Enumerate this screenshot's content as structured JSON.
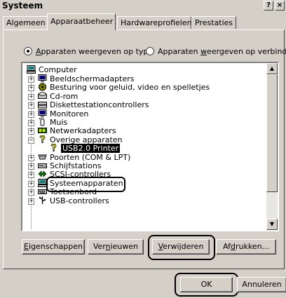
{
  "window": {
    "title": "Systeem",
    "help_label": "?",
    "close_label": "×"
  },
  "tabs": [
    {
      "label": "Algemeen"
    },
    {
      "label": "Apparaatbeheer"
    },
    {
      "label": "Hardwareprofielen"
    },
    {
      "label": "Prestaties"
    }
  ],
  "view_options": {
    "by_type_pre": "",
    "by_type_key": "A",
    "by_type_post": "pparaten weergeven op type",
    "by_connection_pre": "Apparaten ",
    "by_connection_key": "w",
    "by_connection_post": "eergeven op verbinding"
  },
  "tree": {
    "root": "Computer",
    "items": [
      {
        "label": "Beeldschermadapters",
        "icon": "monitor-icon",
        "expander": "+"
      },
      {
        "label": "Besturing voor geluid, video en spelletjes",
        "icon": "sound-icon",
        "expander": "+"
      },
      {
        "label": "Cd-rom",
        "icon": "cdrom-icon",
        "expander": "+"
      },
      {
        "label": "Diskettestationcontrollers",
        "icon": "floppy-controller-icon",
        "expander": "+"
      },
      {
        "label": "Monitoren",
        "icon": "monitor-icon",
        "expander": "+"
      },
      {
        "label": "Muis",
        "icon": "mouse-icon",
        "expander": "+"
      },
      {
        "label": "Netwerkadapters",
        "icon": "network-icon",
        "expander": "+"
      },
      {
        "label": "Overige apparaten",
        "icon": "unknown-device-icon",
        "expander": "−"
      },
      {
        "label": "USB2.0 Printer",
        "icon": "unknown-device-icon",
        "expander": ""
      },
      {
        "label": "Poorten (COM & LPT)",
        "icon": "port-icon",
        "expander": "+"
      },
      {
        "label": "Schijfstations",
        "icon": "disk-icon",
        "expander": "+"
      },
      {
        "label": "SCSI-controllers",
        "icon": "scsi-icon",
        "expander": "+"
      },
      {
        "label": "Systeemapparaten",
        "icon": "system-icon",
        "expander": "+"
      },
      {
        "label": "Toetsenbord",
        "icon": "keyboard-icon",
        "expander": "+"
      },
      {
        "label": "USB-controllers",
        "icon": "usb-icon",
        "expander": "+"
      }
    ]
  },
  "buttons": {
    "properties_pre": "",
    "properties_key": "E",
    "properties_post": "igenschappen",
    "refresh_pre": "Ver",
    "refresh_key": "n",
    "refresh_post": "ieuwen",
    "remove_pre": "",
    "remove_key": "V",
    "remove_post": "erwijderen",
    "print_pre": "Af",
    "print_key": "d",
    "print_post": "rukken...",
    "ok": "OK",
    "cancel": "Annuleren"
  },
  "colors": {
    "face": "#d4d0c8",
    "selection": "#000000"
  }
}
